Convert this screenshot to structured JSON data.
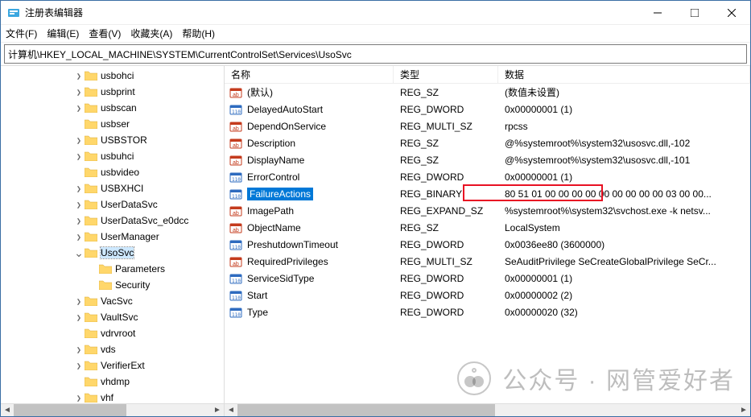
{
  "window": {
    "title": "注册表编辑器"
  },
  "menu": {
    "file": "文件(F)",
    "edit": "编辑(E)",
    "view": "查看(V)",
    "favorites": "收藏夹(A)",
    "help": "帮助(H)"
  },
  "address": "计算机\\HKEY_LOCAL_MACHINE\\SYSTEM\\CurrentControlSet\\Services\\UsoSvc",
  "columns": {
    "name": "名称",
    "type": "类型",
    "data": "数据"
  },
  "tree": [
    {
      "indent": 5,
      "expander": ">",
      "label": "usbohci"
    },
    {
      "indent": 5,
      "expander": ">",
      "label": "usbprint"
    },
    {
      "indent": 5,
      "expander": ">",
      "label": "usbscan"
    },
    {
      "indent": 5,
      "expander": "",
      "label": "usbser"
    },
    {
      "indent": 5,
      "expander": ">",
      "label": "USBSTOR"
    },
    {
      "indent": 5,
      "expander": ">",
      "label": "usbuhci"
    },
    {
      "indent": 5,
      "expander": "",
      "label": "usbvideo"
    },
    {
      "indent": 5,
      "expander": ">",
      "label": "USBXHCI"
    },
    {
      "indent": 5,
      "expander": ">",
      "label": "UserDataSvc"
    },
    {
      "indent": 5,
      "expander": ">",
      "label": "UserDataSvc_e0dcc"
    },
    {
      "indent": 5,
      "expander": ">",
      "label": "UserManager"
    },
    {
      "indent": 5,
      "expander": "v",
      "label": "UsoSvc",
      "selected": true
    },
    {
      "indent": 6,
      "expander": "",
      "label": "Parameters"
    },
    {
      "indent": 6,
      "expander": "",
      "label": "Security"
    },
    {
      "indent": 5,
      "expander": ">",
      "label": "VacSvc"
    },
    {
      "indent": 5,
      "expander": ">",
      "label": "VaultSvc"
    },
    {
      "indent": 5,
      "expander": "",
      "label": "vdrvroot"
    },
    {
      "indent": 5,
      "expander": ">",
      "label": "vds"
    },
    {
      "indent": 5,
      "expander": ">",
      "label": "VerifierExt"
    },
    {
      "indent": 5,
      "expander": "",
      "label": "vhdmp"
    },
    {
      "indent": 5,
      "expander": ">",
      "label": "vhf"
    }
  ],
  "values": [
    {
      "icon": "sz",
      "name": "(默认)",
      "type": "REG_SZ",
      "data": "(数值未设置)"
    },
    {
      "icon": "bin",
      "name": "DelayedAutoStart",
      "type": "REG_DWORD",
      "data": "0x00000001 (1)"
    },
    {
      "icon": "sz",
      "name": "DependOnService",
      "type": "REG_MULTI_SZ",
      "data": "rpcss"
    },
    {
      "icon": "sz",
      "name": "Description",
      "type": "REG_SZ",
      "data": "@%systemroot%\\system32\\usosvc.dll,-102"
    },
    {
      "icon": "sz",
      "name": "DisplayName",
      "type": "REG_SZ",
      "data": "@%systemroot%\\system32\\usosvc.dll,-101"
    },
    {
      "icon": "bin",
      "name": "ErrorControl",
      "type": "REG_DWORD",
      "data": "0x00000001 (1)"
    },
    {
      "icon": "bin",
      "name": "FailureActions",
      "type": "REG_BINARY",
      "data": "80 51 01 00 00 00 00 00 00 00 00 00 03 00 00...",
      "selected": true
    },
    {
      "icon": "sz",
      "name": "ImagePath",
      "type": "REG_EXPAND_SZ",
      "data": "%systemroot%\\system32\\svchost.exe -k netsv..."
    },
    {
      "icon": "sz",
      "name": "ObjectName",
      "type": "REG_SZ",
      "data": "LocalSystem"
    },
    {
      "icon": "bin",
      "name": "PreshutdownTimeout",
      "type": "REG_DWORD",
      "data": "0x0036ee80 (3600000)"
    },
    {
      "icon": "sz",
      "name": "RequiredPrivileges",
      "type": "REG_MULTI_SZ",
      "data": "SeAuditPrivilege SeCreateGlobalPrivilege SeCr..."
    },
    {
      "icon": "bin",
      "name": "ServiceSidType",
      "type": "REG_DWORD",
      "data": "0x00000001 (1)"
    },
    {
      "icon": "bin",
      "name": "Start",
      "type": "REG_DWORD",
      "data": "0x00000002 (2)"
    },
    {
      "icon": "bin",
      "name": "Type",
      "type": "REG_DWORD",
      "data": "0x00000020 (32)"
    }
  ],
  "watermark": "公众号 · 网管爱好者"
}
